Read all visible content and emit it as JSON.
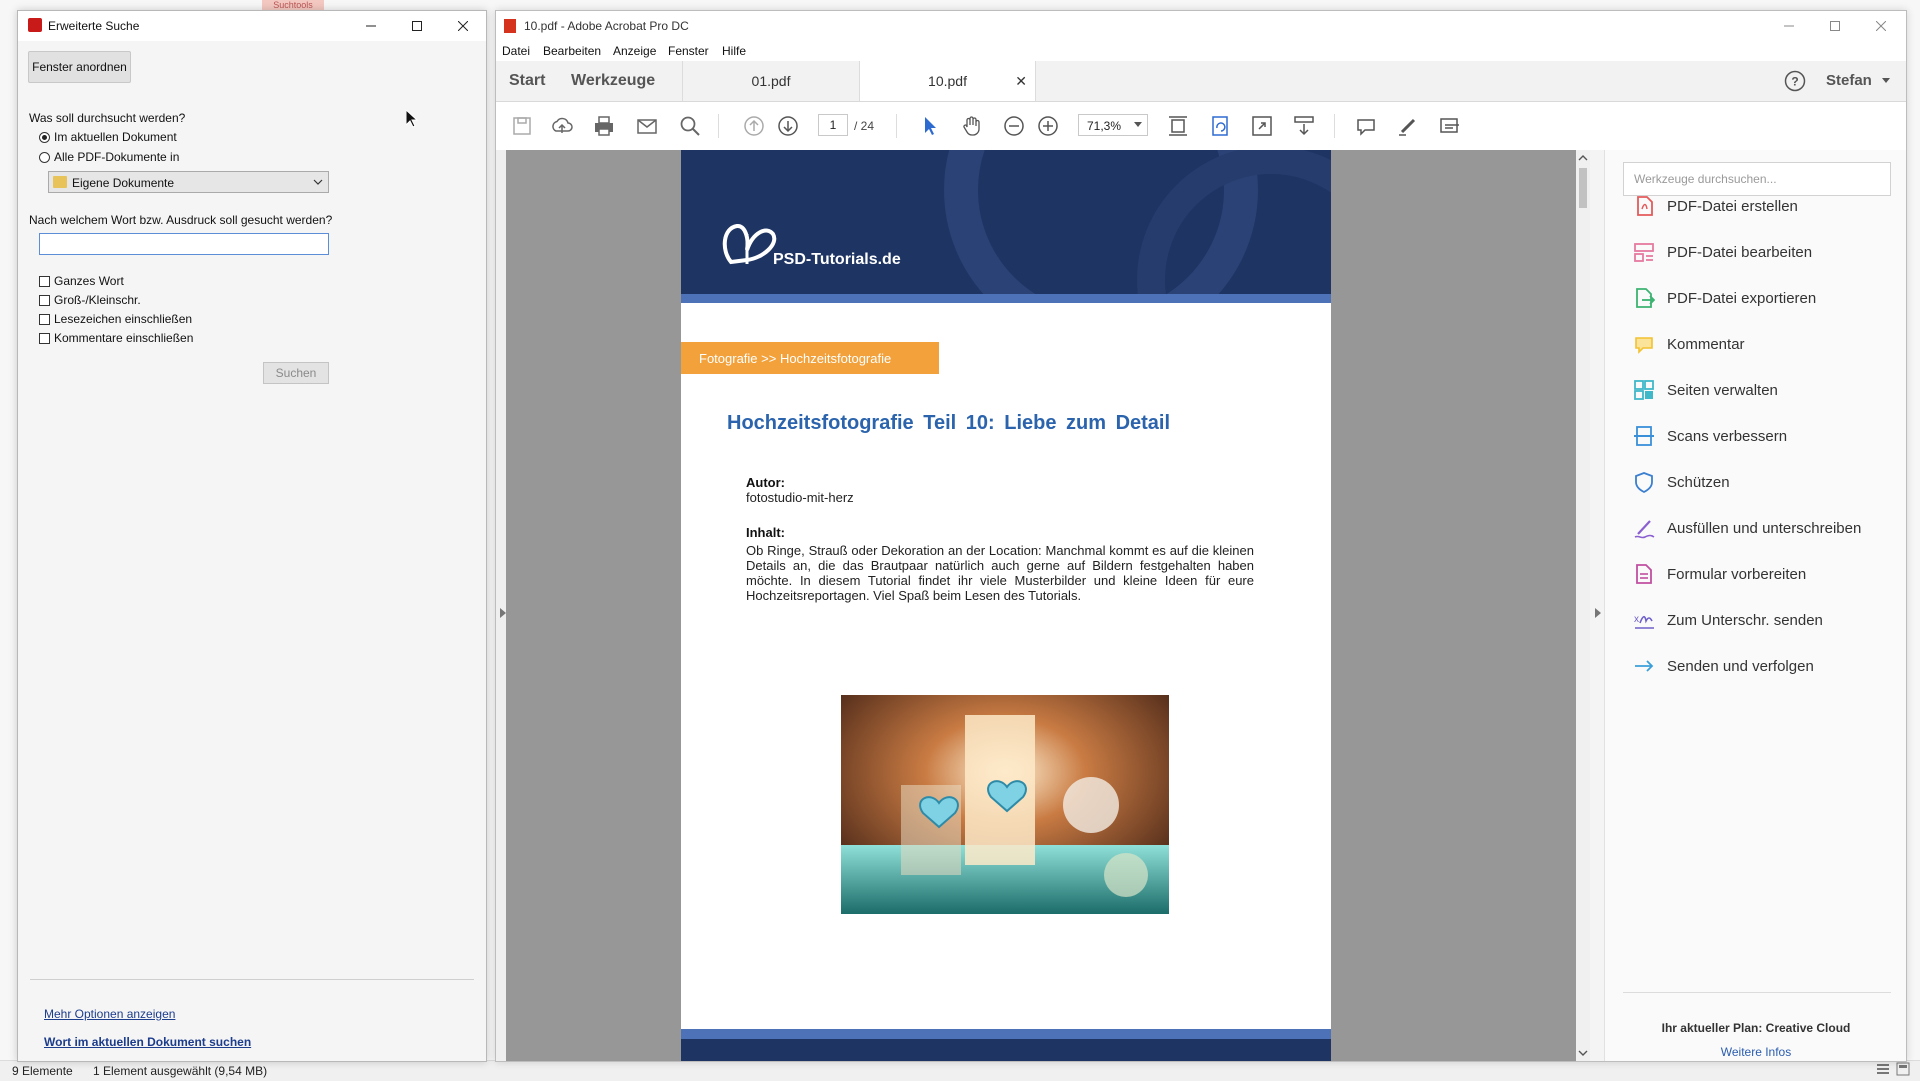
{
  "explorer": {
    "top_tab_label": "Suchtools",
    "status_items": "9 Elemente",
    "status_selection": "1 Element ausgewählt (9,54 MB)"
  },
  "search_window": {
    "title": "Erweiterte Suche",
    "arrange_button": "Fenster anordnen",
    "search_where_label": "Was soll durchsucht werden?",
    "option_current": "Im aktuellen Dokument",
    "option_all": "Alle PDF-Dokumente in",
    "location_value": "Eigene Dokumente",
    "term_label": "Nach welchem Wort bzw. Ausdruck soll gesucht werden?",
    "term_value": "",
    "checkboxes": [
      "Ganzes Wort",
      "Groß-/Kleinschr.",
      "Lesezeichen einschließen",
      "Kommentare einschließen"
    ],
    "search_button": "Suchen",
    "more_options_link": "Mehr Optionen anzeigen",
    "search_word_link": "Wort im aktuellen Dokument suchen"
  },
  "acrobat": {
    "title": "10.pdf - Adobe Acrobat Pro DC",
    "menu": [
      "Datei",
      "Bearbeiten",
      "Anzeige",
      "Fenster",
      "Hilfe"
    ],
    "nav_tabs": [
      "Start",
      "Werkzeuge"
    ],
    "doc_tabs": [
      "01.pdf",
      "10.pdf"
    ],
    "user": "Stefan",
    "page_current": "1",
    "page_total": "/ 24",
    "zoom": "71,3%",
    "tools_search_placeholder": "Werkzeuge durchsuchen...",
    "tools": [
      {
        "label": "PDF-Datei erstellen",
        "color": "#e35a5a",
        "icon": "create-pdf-icon"
      },
      {
        "label": "PDF-Datei bearbeiten",
        "color": "#e77aa0",
        "icon": "edit-pdf-icon"
      },
      {
        "label": "PDF-Datei exportieren",
        "color": "#3cb371",
        "icon": "export-pdf-icon"
      },
      {
        "label": "Kommentar",
        "color": "#f2c230",
        "icon": "comment-icon"
      },
      {
        "label": "Seiten verwalten",
        "color": "#3fb8c9",
        "icon": "organize-pages-icon"
      },
      {
        "label": "Scans verbessern",
        "color": "#3a8fd9",
        "icon": "enhance-scans-icon"
      },
      {
        "label": "Schützen",
        "color": "#3a7fd0",
        "icon": "protect-icon"
      },
      {
        "label": "Ausfüllen und unterschreiben",
        "color": "#8a5fd0",
        "icon": "fill-sign-icon"
      },
      {
        "label": "Formular vorbereiten",
        "color": "#c04fa0",
        "icon": "prepare-form-icon"
      },
      {
        "label": "Zum Unterschr. senden",
        "color": "#6e5fc9",
        "icon": "send-for-signature-icon"
      },
      {
        "label": "Senden und verfolgen",
        "color": "#3a9fd9",
        "icon": "send-track-icon"
      }
    ],
    "plan_text": "Ihr aktueller Plan: Creative Cloud",
    "plan_link": "Weitere Infos"
  },
  "pdf": {
    "logo_text": "PSD-Tutorials.de",
    "breadcrumb": "Fotografie  >>  Hochzeitsfotografie",
    "title": "Hochzeitsfotografie Teil 10: Liebe zum Detail",
    "author_label": "Autor:",
    "author": "fotostudio-mit-herz",
    "content_label": "Inhalt:",
    "content": "Ob Ringe, Strauß oder Dekoration an der Location: Manchmal kommt es auf die kleinen Details an, die das Brautpaar natürlich auch gerne auf Bildern festgehalten haben möchte. In diesem Tutorial findet ihr viele Musterbilder und kleine Ideen für eure Hochzeitsreportagen. Viel Spaß beim Lesen des Tutorials."
  }
}
